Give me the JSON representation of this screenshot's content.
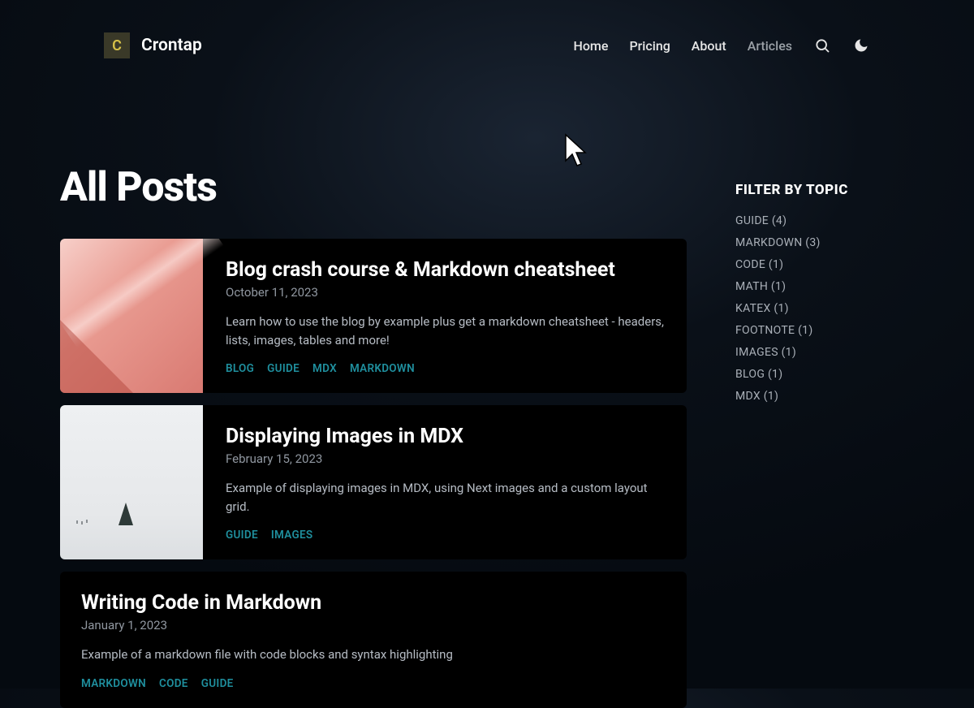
{
  "brand": {
    "logo_letter": "C",
    "name": "Crontap"
  },
  "nav": {
    "items": [
      {
        "label": "Home",
        "active": false
      },
      {
        "label": "Pricing",
        "active": false
      },
      {
        "label": "About",
        "active": false
      },
      {
        "label": "Articles",
        "active": true
      }
    ]
  },
  "page": {
    "title": "All Posts"
  },
  "posts": [
    {
      "title": "Blog crash course & Markdown cheatsheet",
      "date": "October 11, 2023",
      "excerpt": "Learn how to use the blog by example plus get a markdown cheatsheet - headers, lists, images, tables and more!",
      "tags": [
        "BLOG",
        "GUIDE",
        "MDX",
        "MARKDOWN"
      ],
      "thumb": "pink"
    },
    {
      "title": "Displaying Images in MDX",
      "date": "February 15, 2023",
      "excerpt": "Example of displaying images in MDX, using Next images and a custom layout grid.",
      "tags": [
        "GUIDE",
        "IMAGES"
      ],
      "thumb": "snow"
    },
    {
      "title": "Writing Code in Markdown",
      "date": "January 1, 2023",
      "excerpt": "Example of a markdown file with code blocks and syntax highlighting",
      "tags": [
        "MARKDOWN",
        "CODE",
        "GUIDE"
      ],
      "thumb": null
    }
  ],
  "sidebar": {
    "title": "FILTER BY TOPIC",
    "topics": [
      {
        "label": "GUIDE",
        "count": 4
      },
      {
        "label": "MARKDOWN",
        "count": 3
      },
      {
        "label": "CODE",
        "count": 1
      },
      {
        "label": "MATH",
        "count": 1
      },
      {
        "label": "KATEX",
        "count": 1
      },
      {
        "label": "FOOTNOTE",
        "count": 1
      },
      {
        "label": "IMAGES",
        "count": 1
      },
      {
        "label": "BLOG",
        "count": 1
      },
      {
        "label": "MDX",
        "count": 1
      }
    ]
  }
}
